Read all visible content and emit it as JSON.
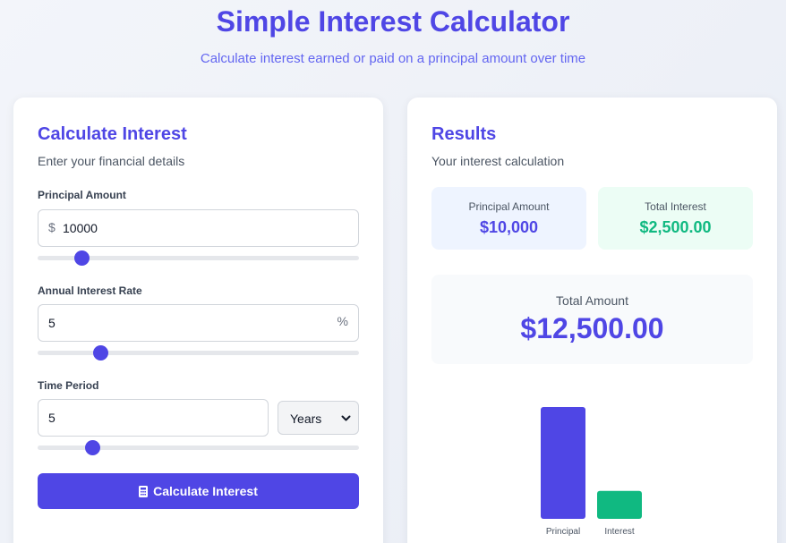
{
  "header": {
    "title": "Simple Interest Calculator",
    "subtitle": "Calculate interest earned or paid on a principal amount over time"
  },
  "calculator": {
    "title": "Calculate Interest",
    "description": "Enter your financial details",
    "principal": {
      "label": "Principal Amount",
      "prefix": "$",
      "value": "10000",
      "slider_fraction": 0.12
    },
    "rate": {
      "label": "Annual Interest Rate",
      "suffix": "%",
      "value": "5",
      "slider_fraction": 0.18
    },
    "time": {
      "label": "Time Period",
      "value": "5",
      "unit": "Years",
      "slider_fraction": 0.155
    },
    "button_label": "Calculate Interest"
  },
  "results": {
    "title": "Results",
    "description": "Your interest calculation",
    "principal_label": "Principal Amount",
    "principal_value": "$10,000",
    "interest_label": "Total Interest",
    "interest_value": "$2,500.00",
    "total_label": "Total Amount",
    "total_value": "$12,500.00"
  },
  "colors": {
    "accent": "#4f46e5",
    "success": "#10b981"
  },
  "chart_data": {
    "type": "bar",
    "categories": [
      "Principal",
      "Interest"
    ],
    "values": [
      10000,
      2500
    ],
    "colors": [
      "#4f46e5",
      "#10b981"
    ],
    "ylim": [
      0,
      10000
    ],
    "grid": false
  }
}
